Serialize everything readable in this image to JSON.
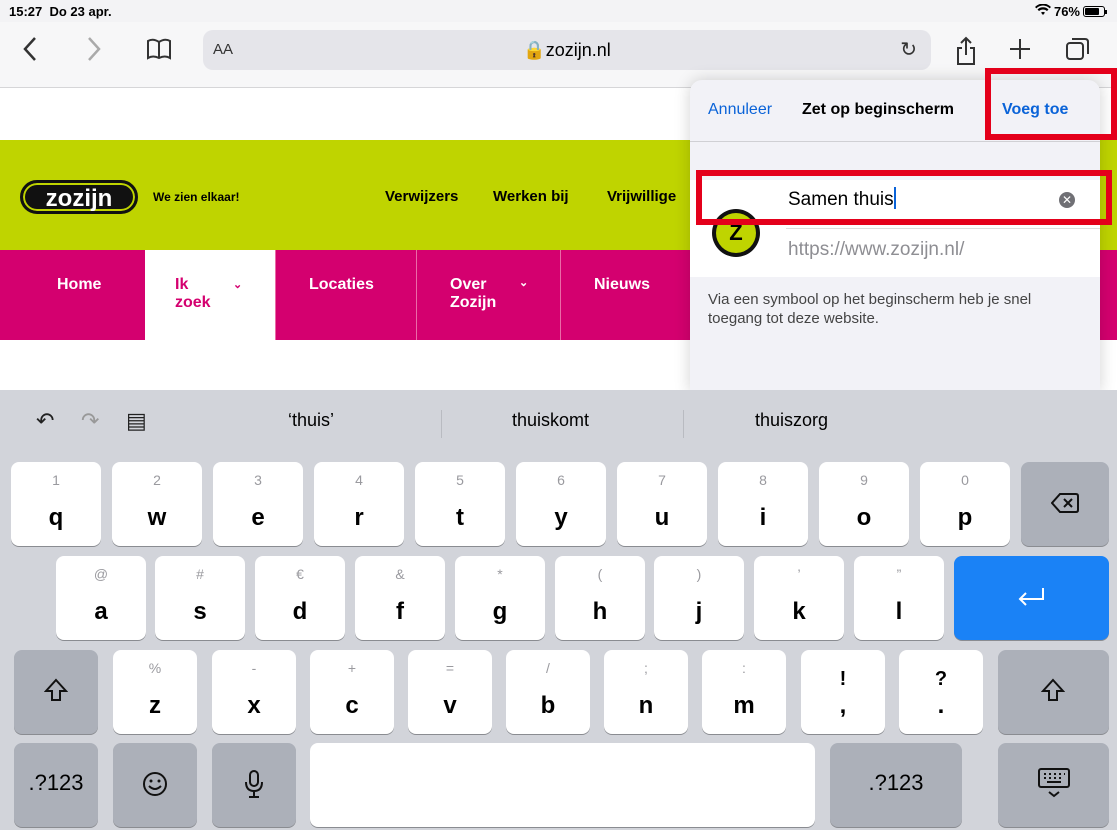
{
  "status": {
    "time": "15:27",
    "date": "Do 23 apr.",
    "battery": "76%"
  },
  "toolbar": {
    "text_size": "AA",
    "url": "zozijn.nl",
    "back_icon": "chevron-left-icon",
    "forward_icon": "chevron-right-icon",
    "bookmarks_icon": "book-icon",
    "reload_icon": "reload-icon",
    "share_icon": "share-icon",
    "new_tab_icon": "plus-icon",
    "tabs_icon": "tabs-icon"
  },
  "site": {
    "logo": "zozijn",
    "slogan": "We zien elkaar!",
    "top_nav": [
      "Verwijzers",
      "Werken bij",
      "Vrijwillige"
    ],
    "main_nav": [
      "Home",
      "Ik zoek",
      "Locaties",
      "Over Zozijn",
      "Nieuws"
    ]
  },
  "popup": {
    "cancel": "Annuleer",
    "title": "Zet op beginscherm",
    "add": "Voeg toe",
    "name_value": "Samen thuis",
    "url": "https://www.zozijn.nl/",
    "description": "Via een symbool op het beginscherm heb je snel toegang tot deze website."
  },
  "keyboard": {
    "suggestions": [
      "‘thuis’",
      "thuiskomt",
      "thuiszorg"
    ],
    "row1": [
      {
        "top": "1",
        "main": "q"
      },
      {
        "top": "2",
        "main": "w"
      },
      {
        "top": "3",
        "main": "e"
      },
      {
        "top": "4",
        "main": "r"
      },
      {
        "top": "5",
        "main": "t"
      },
      {
        "top": "6",
        "main": "y"
      },
      {
        "top": "7",
        "main": "u"
      },
      {
        "top": "8",
        "main": "i"
      },
      {
        "top": "9",
        "main": "o"
      },
      {
        "top": "0",
        "main": "p"
      }
    ],
    "row2": [
      {
        "top": "@",
        "main": "a"
      },
      {
        "top": "#",
        "main": "s"
      },
      {
        "top": "€",
        "main": "d"
      },
      {
        "top": "&",
        "main": "f"
      },
      {
        "top": "*",
        "main": "g"
      },
      {
        "top": "(",
        "main": "h"
      },
      {
        "top": ")",
        "main": "j"
      },
      {
        "top": "’",
        "main": "k"
      },
      {
        "top": "”",
        "main": "l"
      }
    ],
    "row3": [
      {
        "top": "%",
        "main": "z"
      },
      {
        "top": "-",
        "main": "x"
      },
      {
        "top": "+",
        "main": "c"
      },
      {
        "top": "=",
        "main": "v"
      },
      {
        "top": "/",
        "main": "b"
      },
      {
        "top": ";",
        "main": "n"
      },
      {
        "top": ":",
        "main": "m"
      },
      {
        "top": "!",
        "main": ","
      },
      {
        "top": "?",
        "main": "."
      }
    ],
    "numbers_key": ".?123"
  }
}
